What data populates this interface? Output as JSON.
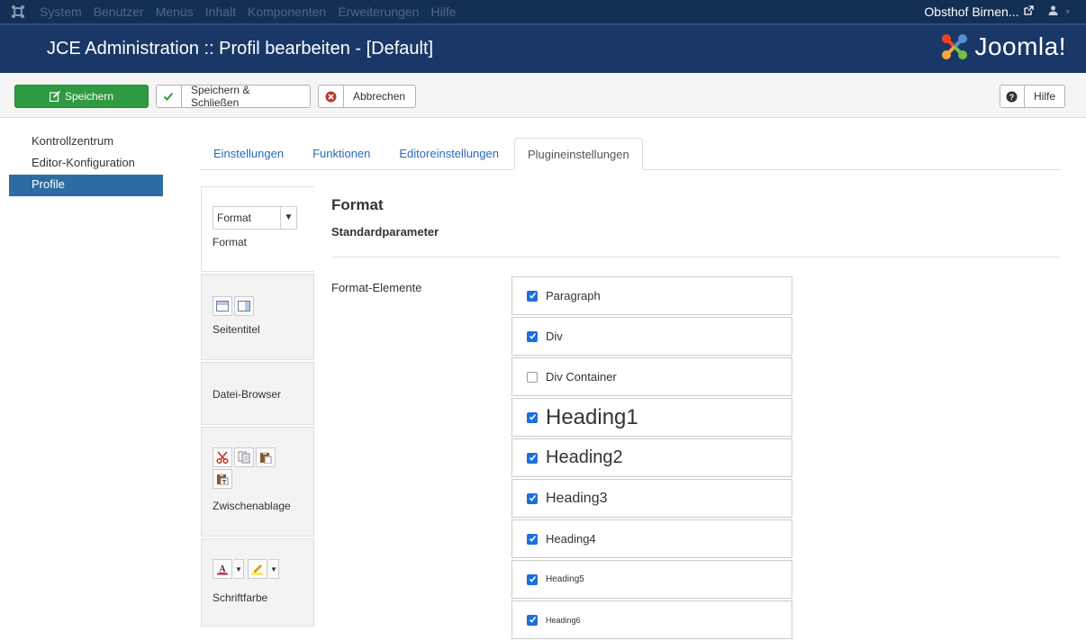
{
  "topbar": {
    "menu": [
      "System",
      "Benutzer",
      "Menüs",
      "Inhalt",
      "Komponenten",
      "Erweiterungen",
      "Hilfe"
    ],
    "site_name": "Obsthof Birnen...",
    "ext_icon": "external-link-icon",
    "user_icon": "user-icon"
  },
  "header": {
    "title": "JCE Administration :: Profil bearbeiten - [Default]",
    "brand": "Joomla!"
  },
  "toolbar": {
    "save": "Speichern",
    "save_close": "Speichern & Schließen",
    "cancel": "Abbrechen",
    "help": "Hilfe"
  },
  "sidebar": {
    "items": [
      {
        "label": "Kontrollzentrum"
      },
      {
        "label": "Editor-Konfiguration"
      },
      {
        "label": "Profile"
      }
    ]
  },
  "tabs": [
    {
      "label": "Einstellungen"
    },
    {
      "label": "Funktionen"
    },
    {
      "label": "Editoreinstellungen"
    },
    {
      "label": "Plugineinstellungen"
    }
  ],
  "plugins": {
    "format_select": "Format",
    "items": [
      {
        "label": "Format"
      },
      {
        "label": "Seitentitel"
      },
      {
        "label": "Datei-Browser"
      },
      {
        "label": "Zwischenablage"
      },
      {
        "label": "Schriftfarbe"
      }
    ]
  },
  "main": {
    "title": "Format",
    "subtitle": "Standardparameter",
    "field_label": "Format-Elemente",
    "options": [
      {
        "label": "Paragraph",
        "checked": true
      },
      {
        "label": "Div",
        "checked": true
      },
      {
        "label": "Div Container",
        "checked": false
      },
      {
        "label": "Heading1",
        "checked": true
      },
      {
        "label": "Heading2",
        "checked": true
      },
      {
        "label": "Heading3",
        "checked": true
      },
      {
        "label": "Heading4",
        "checked": true
      },
      {
        "label": "Heading5",
        "checked": true
      },
      {
        "label": "Heading6",
        "checked": true
      }
    ]
  },
  "colors": {
    "topbar": "#132f53",
    "header": "#1a3867",
    "save_button": "#2f9a41",
    "sidebar_active": "#2d6ca2",
    "tab_link": "#2a69b8",
    "checkbox": "#1c6ee0"
  }
}
